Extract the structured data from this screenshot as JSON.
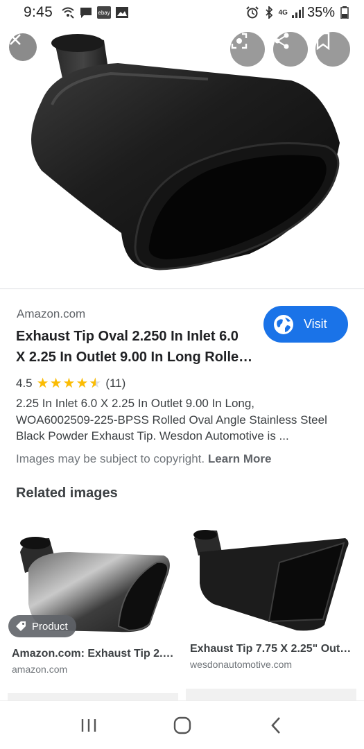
{
  "status_bar": {
    "time": "9:45",
    "left_icons": [
      "wifi-call-icon",
      "message-icon",
      "ebay-icon",
      "image-icon"
    ],
    "ebay_label": "ebay",
    "network_label": "4G",
    "battery": "35%"
  },
  "hero": {
    "close_icon": "close-icon",
    "actions": [
      "lens-icon",
      "share-icon",
      "bookmark-icon"
    ]
  },
  "result": {
    "source": "Amazon.com",
    "title_line1": "Exhaust Tip Oval 2.250 In Inlet 6.0",
    "title_line2": "X 2.25 In Outlet 9.00 In Long Rolle…",
    "visit_label": "Visit",
    "rating": "4.5",
    "rating_value": 4.5,
    "review_count": "(11)",
    "description_line1": "2.25 In Inlet 6.0 X 2.25 In Outlet 9.00 In Long,",
    "description_line2": "WOA6002509-225-BPSS Rolled Oval Angle Stainless Steel",
    "description_line3": "Black Powder Exhaust Tip. Wesdon Automotive is ...",
    "copyright_text": "Images may be subject to copyright.",
    "learn_more": "Learn More"
  },
  "related": {
    "heading": "Related images",
    "cards": [
      {
        "title": "Amazon.com: Exhaust Tip 2.2…",
        "domain": "amazon.com",
        "badge": "Product"
      },
      {
        "title": "Exhaust Tip 7.75 X 2.25\" Outl…",
        "domain": "wesdonautomotive.com"
      }
    ]
  },
  "nav": {
    "buttons": [
      "recents-icon",
      "home-icon",
      "back-icon"
    ]
  },
  "colors": {
    "accent": "#1a73e8",
    "star": "#fbbc04"
  }
}
